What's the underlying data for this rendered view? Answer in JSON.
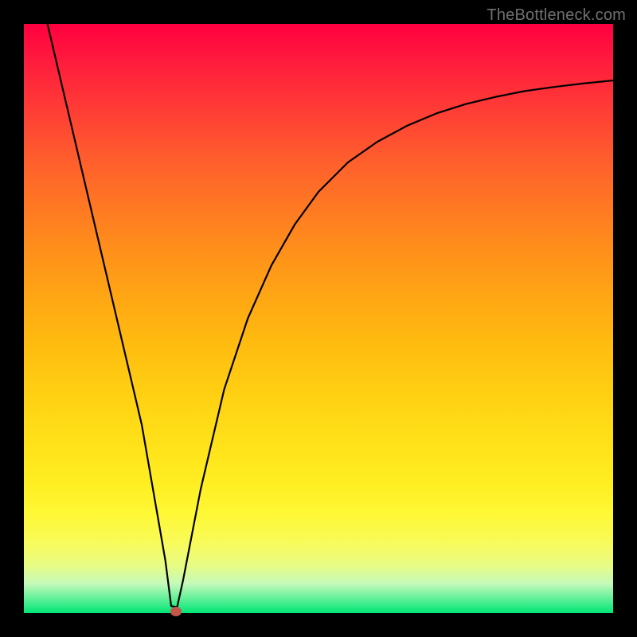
{
  "watermark": "TheBottleneck.com",
  "marker": {
    "x_pct": 0.2581,
    "y_pct": 0.9973
  },
  "colors": {
    "frame": "#000000",
    "curve": "#000000",
    "marker": "#c4564a",
    "watermark": "#707070"
  },
  "chart_data": {
    "type": "line",
    "title": "",
    "xlabel": "",
    "ylabel": "",
    "xlim": [
      0,
      1
    ],
    "ylim": [
      0,
      1
    ],
    "series": [
      {
        "name": "bottleneck-curve",
        "x": [
          0.04,
          0.08,
          0.12,
          0.16,
          0.2,
          0.24,
          0.25,
          0.26,
          0.27,
          0.3,
          0.34,
          0.38,
          0.42,
          0.46,
          0.5,
          0.55,
          0.6,
          0.65,
          0.7,
          0.75,
          0.8,
          0.85,
          0.9,
          0.95,
          1.0
        ],
        "y": [
          1.0,
          0.83,
          0.66,
          0.49,
          0.32,
          0.09,
          0.012,
          0.01,
          0.055,
          0.21,
          0.38,
          0.5,
          0.59,
          0.66,
          0.715,
          0.765,
          0.8,
          0.827,
          0.848,
          0.864,
          0.876,
          0.886,
          0.893,
          0.899,
          0.904
        ]
      }
    ],
    "annotations": [
      {
        "type": "marker-dot",
        "x": 0.2581,
        "y": 0.003,
        "color": "#c4564a"
      }
    ],
    "background": {
      "type": "vertical-gradient",
      "stops": [
        {
          "pos": 0.0,
          "color": "#ff0040"
        },
        {
          "pos": 0.5,
          "color": "#ffb010"
        },
        {
          "pos": 0.82,
          "color": "#fff030"
        },
        {
          "pos": 1.0,
          "color": "#00e676"
        }
      ]
    }
  }
}
